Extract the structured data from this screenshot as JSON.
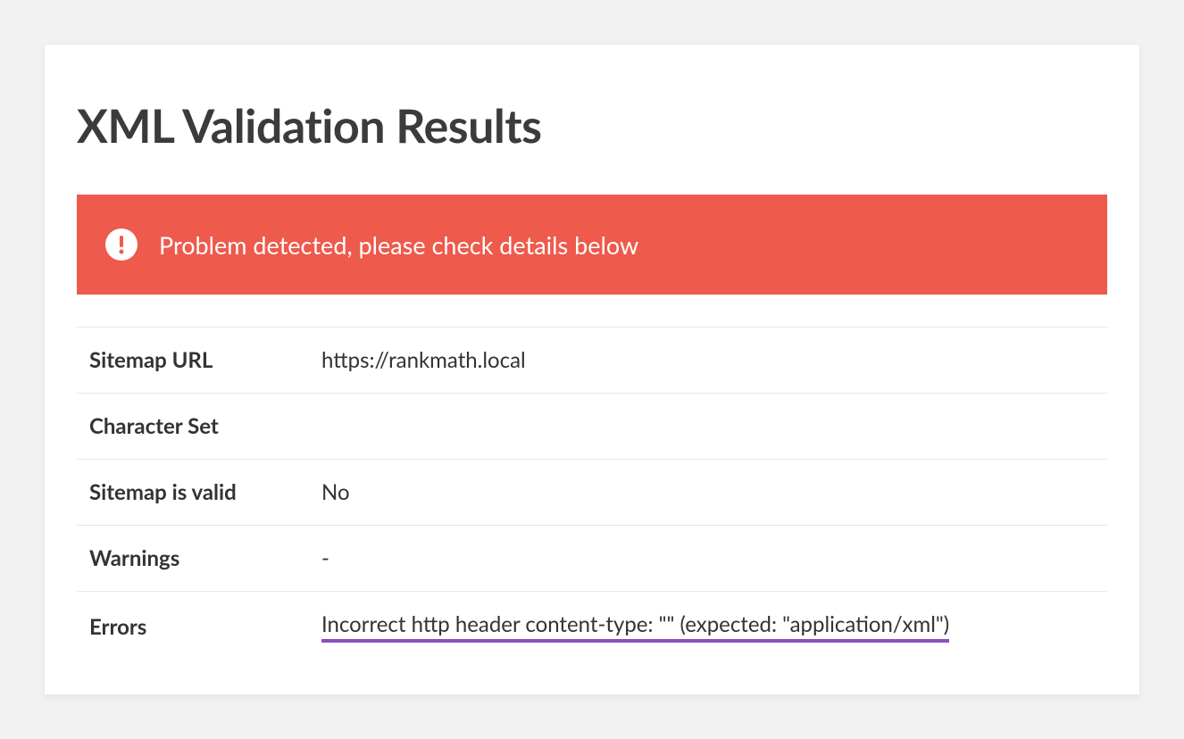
{
  "title": "XML Validation Results",
  "alert": {
    "message": "Problem detected, please check details below"
  },
  "details": {
    "sitemap_url": {
      "label": "Sitemap URL",
      "value": "https://rankmath.local"
    },
    "character_set": {
      "label": "Character Set",
      "value": ""
    },
    "sitemap_valid": {
      "label": "Sitemap is valid",
      "value": "No"
    },
    "warnings": {
      "label": "Warnings",
      "value": "-"
    },
    "errors": {
      "label": "Errors",
      "value": "Incorrect http header content-type: \"\" (expected: \"application/xml\")"
    }
  }
}
